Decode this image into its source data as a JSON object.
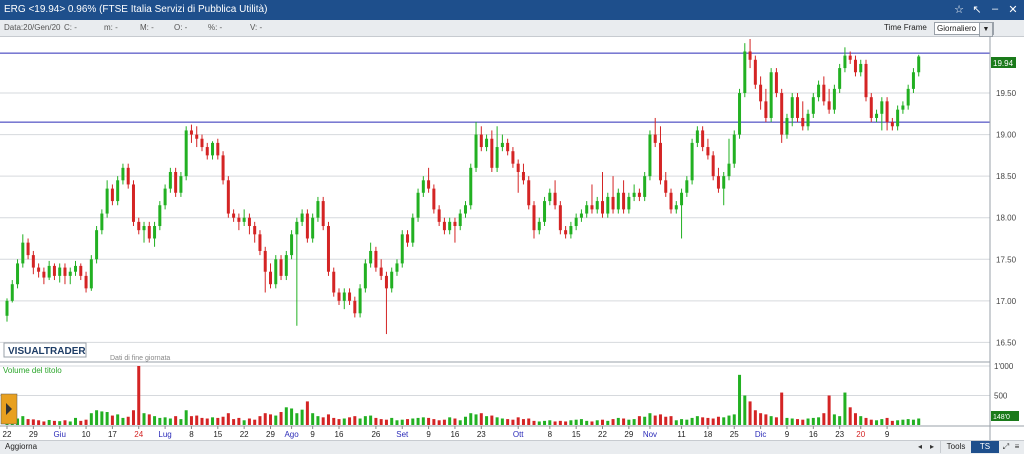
{
  "window": {
    "title": "ERG <19.94> 0.96%  (FTSE Italia Servizi di Pubblica Utilità)"
  },
  "infobar": {
    "data": "Data:20/Gen/20",
    "c": "C: -",
    "m": "m: -",
    "M": "M: -",
    "O": "O: -",
    "pct": "%: -",
    "V": "V: -",
    "timeframe_label": "Time Frame",
    "timeframe_value": "Giornaliero"
  },
  "watermark": {
    "brand": "VISUALTRADER",
    "note": "Dati di fine giornata"
  },
  "footer": {
    "refresh_label": "Aggiorna",
    "tools_label": "Tools",
    "tsoff_label": "TS OFF"
  },
  "colors": {
    "up": "#22b022",
    "down": "#d42424",
    "hline": "#2b2bb8",
    "price_badge": "#1a7a1a"
  },
  "chart_data": {
    "type": "candlestick",
    "price_axis": {
      "min": 16.3,
      "max": 20.15,
      "ticks": [
        "16.50",
        "17.00",
        "17.50",
        "18.00",
        "18.50",
        "19.00",
        "19.50"
      ]
    },
    "volume_axis": {
      "max": 1000,
      "ticks": [
        "1'000",
        "500"
      ]
    },
    "last_price_label": "19.94",
    "horizontal_lines": [
      19.98,
      19.15
    ],
    "volume_title": "Volume del titolo",
    "volume_value_label": "148'0",
    "x_tick_labels": [
      {
        "label": "22",
        "i": 0,
        "color": "#222222"
      },
      {
        "label": "29",
        "i": 5,
        "color": "#222222"
      },
      {
        "label": "Giu",
        "i": 10,
        "color": "#2b2bb8"
      },
      {
        "label": "10",
        "i": 15,
        "color": "#222222"
      },
      {
        "label": "17",
        "i": 20,
        "color": "#222222"
      },
      {
        "label": "24",
        "i": 25,
        "color": "#d42424"
      },
      {
        "label": "Lug",
        "i": 30,
        "color": "#2b2bb8"
      },
      {
        "label": "8",
        "i": 35,
        "color": "#222222"
      },
      {
        "label": "15",
        "i": 40,
        "color": "#222222"
      },
      {
        "label": "22",
        "i": 45,
        "color": "#222222"
      },
      {
        "label": "29",
        "i": 50,
        "color": "#222222"
      },
      {
        "label": "Ago",
        "i": 54,
        "color": "#2b2bb8"
      },
      {
        "label": "9",
        "i": 58,
        "color": "#222222"
      },
      {
        "label": "16",
        "i": 63,
        "color": "#222222"
      },
      {
        "label": "26",
        "i": 70,
        "color": "#222222"
      },
      {
        "label": "Set",
        "i": 75,
        "color": "#2b2bb8"
      },
      {
        "label": "9",
        "i": 80,
        "color": "#222222"
      },
      {
        "label": "16",
        "i": 85,
        "color": "#222222"
      },
      {
        "label": "23",
        "i": 90,
        "color": "#222222"
      },
      {
        "label": "Ott",
        "i": 97,
        "color": "#2b2bb8"
      },
      {
        "label": "8",
        "i": 103,
        "color": "#222222"
      },
      {
        "label": "15",
        "i": 108,
        "color": "#222222"
      },
      {
        "label": "22",
        "i": 113,
        "color": "#222222"
      },
      {
        "label": "29",
        "i": 118,
        "color": "#222222"
      },
      {
        "label": "Nov",
        "i": 122,
        "color": "#2b2bb8"
      },
      {
        "label": "11",
        "i": 128,
        "color": "#222222"
      },
      {
        "label": "18",
        "i": 133,
        "color": "#222222"
      },
      {
        "label": "25",
        "i": 138,
        "color": "#222222"
      },
      {
        "label": "Dic",
        "i": 143,
        "color": "#2b2bb8"
      },
      {
        "label": "9",
        "i": 148,
        "color": "#222222"
      },
      {
        "label": "16",
        "i": 153,
        "color": "#222222"
      },
      {
        "label": "23",
        "i": 158,
        "color": "#222222"
      },
      {
        "label": "20",
        "i": 162,
        "color": "#d42424"
      },
      {
        "label": "9",
        "i": 167,
        "color": "#222222"
      }
    ],
    "candles": [
      [
        16.82,
        17.0,
        16.75,
        17.03,
        120
      ],
      [
        17.0,
        17.2,
        16.98,
        17.25,
        90
      ],
      [
        17.2,
        17.45,
        17.15,
        17.5,
        110
      ],
      [
        17.45,
        17.7,
        17.4,
        17.8,
        150
      ],
      [
        17.7,
        17.55,
        17.5,
        17.75,
        100
      ],
      [
        17.55,
        17.4,
        17.32,
        17.6,
        95
      ],
      [
        17.4,
        17.35,
        17.28,
        17.45,
        80
      ],
      [
        17.35,
        17.28,
        17.2,
        17.4,
        60
      ],
      [
        17.28,
        17.42,
        17.25,
        17.48,
        85
      ],
      [
        17.42,
        17.3,
        17.25,
        17.45,
        70
      ],
      [
        17.3,
        17.4,
        17.22,
        17.45,
        65
      ],
      [
        17.4,
        17.3,
        17.2,
        17.45,
        80
      ],
      [
        17.3,
        17.35,
        17.2,
        17.4,
        60
      ],
      [
        17.35,
        17.42,
        17.3,
        17.48,
        120
      ],
      [
        17.42,
        17.3,
        17.25,
        17.45,
        70
      ],
      [
        17.3,
        17.15,
        17.1,
        17.35,
        90
      ],
      [
        17.15,
        17.5,
        17.12,
        17.55,
        200
      ],
      [
        17.5,
        17.85,
        17.45,
        17.9,
        250
      ],
      [
        17.85,
        18.05,
        17.8,
        18.1,
        230
      ],
      [
        18.05,
        18.35,
        18.0,
        18.45,
        220
      ],
      [
        18.35,
        18.2,
        18.15,
        18.4,
        160
      ],
      [
        18.2,
        18.45,
        18.15,
        18.5,
        180
      ],
      [
        18.45,
        18.6,
        18.4,
        18.65,
        120
      ],
      [
        18.6,
        18.4,
        18.35,
        18.65,
        140
      ],
      [
        18.4,
        17.95,
        17.9,
        18.45,
        250
      ],
      [
        17.95,
        17.85,
        17.8,
        18.0,
        1000
      ],
      [
        17.85,
        17.9,
        17.7,
        17.95,
        200
      ],
      [
        17.9,
        17.75,
        17.7,
        17.95,
        180
      ],
      [
        17.75,
        17.9,
        17.65,
        17.95,
        150
      ],
      [
        17.9,
        18.15,
        17.85,
        18.2,
        120
      ],
      [
        18.15,
        18.35,
        18.1,
        18.4,
        130
      ],
      [
        18.35,
        18.55,
        18.3,
        18.6,
        110
      ],
      [
        18.55,
        18.3,
        18.25,
        18.6,
        150
      ],
      [
        18.3,
        18.5,
        18.25,
        18.55,
        100
      ],
      [
        18.5,
        19.05,
        18.45,
        19.1,
        250
      ],
      [
        19.05,
        19.0,
        18.9,
        19.12,
        150
      ],
      [
        19.0,
        18.95,
        18.85,
        19.1,
        160
      ],
      [
        18.95,
        18.85,
        18.8,
        19.0,
        120
      ],
      [
        18.85,
        18.75,
        18.7,
        18.9,
        110
      ],
      [
        18.75,
        18.9,
        18.7,
        18.92,
        130
      ],
      [
        18.9,
        18.75,
        18.7,
        18.95,
        120
      ],
      [
        18.75,
        18.45,
        18.4,
        18.8,
        140
      ],
      [
        18.45,
        18.05,
        18.0,
        18.5,
        200
      ],
      [
        18.05,
        18.0,
        17.95,
        18.1,
        100
      ],
      [
        18.0,
        17.95,
        17.85,
        18.05,
        120
      ],
      [
        17.95,
        18.0,
        17.9,
        18.1,
        80
      ],
      [
        18.0,
        17.9,
        17.8,
        18.05,
        110
      ],
      [
        17.9,
        17.8,
        17.7,
        17.95,
        90
      ],
      [
        17.8,
        17.6,
        17.55,
        17.85,
        150
      ],
      [
        17.6,
        17.35,
        17.1,
        17.65,
        200
      ],
      [
        17.35,
        17.2,
        17.15,
        17.45,
        180
      ],
      [
        17.2,
        17.5,
        17.15,
        17.55,
        160
      ],
      [
        17.5,
        17.3,
        17.25,
        17.55,
        220
      ],
      [
        17.3,
        17.55,
        17.25,
        17.6,
        300
      ],
      [
        17.55,
        17.8,
        17.5,
        17.85,
        280
      ],
      [
        17.8,
        17.95,
        16.7,
        18.0,
        200
      ],
      [
        17.95,
        18.05,
        17.9,
        18.1,
        260
      ],
      [
        18.05,
        17.75,
        17.7,
        18.1,
        400
      ],
      [
        17.75,
        18.0,
        17.7,
        18.05,
        200
      ],
      [
        18.0,
        18.2,
        17.95,
        18.25,
        150
      ],
      [
        18.2,
        17.9,
        17.85,
        18.25,
        130
      ],
      [
        17.9,
        17.35,
        17.3,
        17.95,
        180
      ],
      [
        17.35,
        17.1,
        17.05,
        17.4,
        120
      ],
      [
        17.1,
        17.0,
        16.95,
        17.15,
        100
      ],
      [
        17.0,
        17.1,
        16.9,
        17.15,
        110
      ],
      [
        17.1,
        17.0,
        16.95,
        17.15,
        130
      ],
      [
        17.0,
        16.85,
        16.8,
        17.05,
        150
      ],
      [
        16.85,
        17.15,
        16.8,
        17.2,
        110
      ],
      [
        17.15,
        17.45,
        17.1,
        17.5,
        150
      ],
      [
        17.45,
        17.6,
        17.4,
        17.7,
        160
      ],
      [
        17.6,
        17.4,
        17.35,
        17.65,
        120
      ],
      [
        17.4,
        17.3,
        17.25,
        17.5,
        100
      ],
      [
        17.3,
        17.15,
        16.6,
        17.35,
        90
      ],
      [
        17.15,
        17.35,
        17.1,
        17.4,
        120
      ],
      [
        17.35,
        17.45,
        17.3,
        17.5,
        80
      ],
      [
        17.45,
        17.8,
        17.4,
        17.85,
        90
      ],
      [
        17.8,
        17.7,
        17.65,
        17.85,
        100
      ],
      [
        17.7,
        18.0,
        17.65,
        18.05,
        110
      ],
      [
        18.0,
        18.3,
        17.95,
        18.35,
        120
      ],
      [
        18.3,
        18.45,
        18.25,
        18.5,
        130
      ],
      [
        18.45,
        18.35,
        18.3,
        18.6,
        120
      ],
      [
        18.35,
        18.1,
        18.05,
        18.4,
        100
      ],
      [
        18.1,
        17.95,
        17.9,
        18.15,
        80
      ],
      [
        17.95,
        17.85,
        17.8,
        18.0,
        90
      ],
      [
        17.85,
        17.95,
        17.8,
        18.0,
        130
      ],
      [
        17.95,
        17.9,
        17.7,
        18.0,
        110
      ],
      [
        17.9,
        18.05,
        17.85,
        18.1,
        80
      ],
      [
        18.05,
        18.15,
        18.0,
        18.2,
        140
      ],
      [
        18.15,
        18.6,
        18.1,
        18.65,
        200
      ],
      [
        18.6,
        19.0,
        18.55,
        19.15,
        180
      ],
      [
        19.0,
        18.85,
        18.8,
        19.1,
        200
      ],
      [
        18.85,
        18.95,
        18.8,
        19.0,
        150
      ],
      [
        18.95,
        18.6,
        18.55,
        19.05,
        160
      ],
      [
        18.6,
        18.85,
        18.55,
        19.1,
        130
      ],
      [
        18.85,
        18.9,
        18.8,
        19.0,
        110
      ],
      [
        18.9,
        18.8,
        18.75,
        18.95,
        100
      ],
      [
        18.8,
        18.65,
        18.6,
        18.85,
        90
      ],
      [
        18.65,
        18.55,
        18.3,
        18.7,
        130
      ],
      [
        18.55,
        18.45,
        18.4,
        18.65,
        100
      ],
      [
        18.45,
        18.15,
        18.1,
        18.5,
        110
      ],
      [
        18.15,
        17.85,
        17.75,
        18.2,
        70
      ],
      [
        17.85,
        17.95,
        17.8,
        18.0,
        60
      ],
      [
        17.95,
        18.2,
        17.9,
        18.25,
        70
      ],
      [
        18.2,
        18.3,
        18.15,
        18.35,
        80
      ],
      [
        18.3,
        18.15,
        18.1,
        18.45,
        60
      ],
      [
        18.15,
        17.85,
        17.8,
        18.2,
        70
      ],
      [
        17.85,
        17.8,
        17.75,
        17.9,
        60
      ],
      [
        17.8,
        17.9,
        17.75,
        17.95,
        80
      ],
      [
        17.9,
        18.0,
        17.85,
        18.05,
        90
      ],
      [
        18.0,
        18.05,
        17.95,
        18.1,
        100
      ],
      [
        18.05,
        18.15,
        18.0,
        18.2,
        70
      ],
      [
        18.15,
        18.1,
        18.05,
        18.4,
        60
      ],
      [
        18.1,
        18.2,
        18.05,
        18.25,
        80
      ],
      [
        18.2,
        18.05,
        18.0,
        18.55,
        90
      ],
      [
        18.05,
        18.25,
        18.0,
        18.3,
        70
      ],
      [
        18.25,
        18.1,
        18.05,
        18.5,
        100
      ],
      [
        18.1,
        18.3,
        18.05,
        18.35,
        120
      ],
      [
        18.3,
        18.1,
        18.05,
        18.45,
        110
      ],
      [
        18.1,
        18.25,
        18.05,
        18.3,
        90
      ],
      [
        18.25,
        18.3,
        18.2,
        18.4,
        100
      ],
      [
        18.3,
        18.25,
        18.2,
        18.35,
        150
      ],
      [
        18.25,
        18.5,
        18.2,
        18.55,
        140
      ],
      [
        18.5,
        19.0,
        18.45,
        19.05,
        200
      ],
      [
        19.0,
        18.9,
        18.85,
        19.2,
        160
      ],
      [
        18.9,
        18.45,
        18.4,
        19.1,
        180
      ],
      [
        18.45,
        18.3,
        18.25,
        18.55,
        140
      ],
      [
        18.3,
        18.1,
        18.05,
        18.35,
        150
      ],
      [
        18.1,
        18.15,
        18.05,
        18.2,
        80
      ],
      [
        18.15,
        18.3,
        17.75,
        18.35,
        100
      ],
      [
        18.3,
        18.45,
        18.25,
        18.5,
        90
      ],
      [
        18.45,
        18.9,
        18.4,
        18.95,
        120
      ],
      [
        18.9,
        19.05,
        18.85,
        19.1,
        150
      ],
      [
        19.05,
        18.85,
        18.8,
        19.1,
        130
      ],
      [
        18.85,
        18.75,
        18.7,
        18.95,
        120
      ],
      [
        18.75,
        18.5,
        18.45,
        18.8,
        110
      ],
      [
        18.5,
        18.35,
        18.3,
        18.6,
        140
      ],
      [
        18.35,
        18.5,
        18.15,
        18.55,
        130
      ],
      [
        18.5,
        18.65,
        18.45,
        18.95,
        160
      ],
      [
        18.65,
        19.0,
        18.6,
        19.05,
        180
      ],
      [
        19.0,
        19.5,
        18.95,
        19.55,
        850
      ],
      [
        19.5,
        20.0,
        19.45,
        20.1,
        500
      ],
      [
        20.0,
        19.9,
        19.8,
        20.15,
        400
      ],
      [
        19.9,
        19.6,
        19.55,
        19.95,
        250
      ],
      [
        19.6,
        19.4,
        19.3,
        19.7,
        200
      ],
      [
        19.4,
        19.2,
        19.15,
        19.55,
        180
      ],
      [
        19.2,
        19.75,
        19.15,
        19.8,
        150
      ],
      [
        19.75,
        19.5,
        19.45,
        19.8,
        130
      ],
      [
        19.5,
        19.0,
        18.9,
        19.55,
        550
      ],
      [
        19.0,
        19.2,
        18.95,
        19.25,
        120
      ],
      [
        19.2,
        19.45,
        19.1,
        19.5,
        110
      ],
      [
        19.45,
        19.2,
        19.15,
        19.5,
        100
      ],
      [
        19.2,
        19.1,
        19.05,
        19.4,
        90
      ],
      [
        19.1,
        19.25,
        19.05,
        19.3,
        110
      ],
      [
        19.25,
        19.45,
        19.2,
        19.5,
        120
      ],
      [
        19.45,
        19.6,
        19.4,
        19.65,
        130
      ],
      [
        19.6,
        19.4,
        19.35,
        19.7,
        200
      ],
      [
        19.4,
        19.3,
        19.25,
        19.55,
        500
      ],
      [
        19.3,
        19.55,
        19.25,
        19.6,
        180
      ],
      [
        19.55,
        19.8,
        19.5,
        19.85,
        150
      ],
      [
        19.8,
        19.95,
        19.75,
        20.05,
        550
      ],
      [
        19.95,
        19.9,
        19.85,
        20.0,
        300
      ],
      [
        19.9,
        19.75,
        19.7,
        19.95,
        200
      ],
      [
        19.75,
        19.85,
        19.7,
        19.9,
        150
      ],
      [
        19.85,
        19.45,
        19.4,
        19.9,
        120
      ],
      [
        19.45,
        19.2,
        19.15,
        19.5,
        90
      ],
      [
        19.2,
        19.25,
        19.15,
        19.3,
        80
      ],
      [
        19.25,
        19.4,
        19.05,
        19.45,
        100
      ],
      [
        19.4,
        19.15,
        19.05,
        19.45,
        120
      ],
      [
        19.15,
        19.1,
        19.05,
        19.2,
        70
      ],
      [
        19.1,
        19.3,
        19.05,
        19.35,
        80
      ],
      [
        19.3,
        19.35,
        19.25,
        19.4,
        90
      ],
      [
        19.35,
        19.55,
        19.3,
        19.6,
        100
      ],
      [
        19.55,
        19.75,
        19.5,
        19.8,
        90
      ],
      [
        19.75,
        19.94,
        19.7,
        19.96,
        110
      ]
    ]
  }
}
